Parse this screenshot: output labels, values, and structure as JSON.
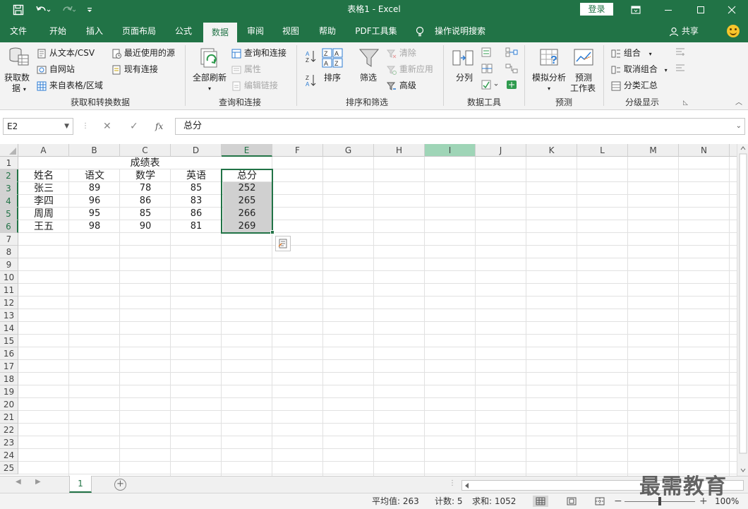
{
  "app": {
    "title": "表格1  -  Excel",
    "login_label": "登录"
  },
  "tabs": [
    "文件",
    "开始",
    "插入",
    "页面布局",
    "公式",
    "数据",
    "审阅",
    "视图",
    "帮助",
    "PDF工具集",
    "操作说明搜索"
  ],
  "active_tab_index": 5,
  "share_label": "共享",
  "ribbon": {
    "get_transform": {
      "get_data_line1": "获取数",
      "get_data_line2": "据",
      "from_text_csv": "从文本/CSV",
      "from_web": "自网站",
      "from_table": "来自表格/区域",
      "recent_sources": "最近使用的源",
      "existing_connections": "现有连接",
      "group_label": "获取和转换数据"
    },
    "queries": {
      "refresh_all": "全部刷新",
      "queries_connections": "查询和连接",
      "properties": "属性",
      "edit_links": "编辑链接",
      "group_label": "查询和连接"
    },
    "sort_filter": {
      "sort": "排序",
      "filter": "筛选",
      "clear": "清除",
      "reapply": "重新应用",
      "advanced": "高级",
      "group_label": "排序和筛选"
    },
    "data_tools": {
      "text_to_columns": "分列",
      "group_label": "数据工具"
    },
    "forecast": {
      "what_if": "模拟分析",
      "forecast_sheet_line1": "预测",
      "forecast_sheet_line2": "工作表",
      "group_label": "预测"
    },
    "outline": {
      "group": "组合",
      "ungroup": "取消组合",
      "subtotal": "分类汇总",
      "group_label": "分级显示"
    }
  },
  "formula_bar": {
    "name_box": "E2",
    "fx_label": "fx",
    "formula": "总分"
  },
  "columns": [
    "A",
    "B",
    "C",
    "D",
    "E",
    "F",
    "G",
    "H",
    "I",
    "J",
    "K",
    "L",
    "M",
    "N"
  ],
  "rows": [
    "1",
    "2",
    "3",
    "4",
    "5",
    "6",
    "7",
    "8",
    "9",
    "10",
    "11",
    "12",
    "13",
    "14",
    "15",
    "16",
    "17",
    "18",
    "19",
    "20",
    "21",
    "22",
    "23",
    "24",
    "25"
  ],
  "sheet": {
    "title": "成绩表",
    "headers": [
      "姓名",
      "语文",
      "数学",
      "英语",
      "总分"
    ],
    "records": [
      [
        "张三",
        "89",
        "78",
        "85",
        "252"
      ],
      [
        "李四",
        "96",
        "86",
        "83",
        "265"
      ],
      [
        "周周",
        "95",
        "85",
        "86",
        "266"
      ],
      [
        "王五",
        "98",
        "90",
        "81",
        "269"
      ]
    ]
  },
  "sheet_tabs": [
    "1"
  ],
  "status": {
    "average": "平均值: 263",
    "count": "计数: 5",
    "sum": "求和: 1052",
    "zoom": "100%"
  },
  "watermark": "最需教育",
  "colors": {
    "accent": "#217346",
    "selection_fill": "#d0d0d0"
  }
}
